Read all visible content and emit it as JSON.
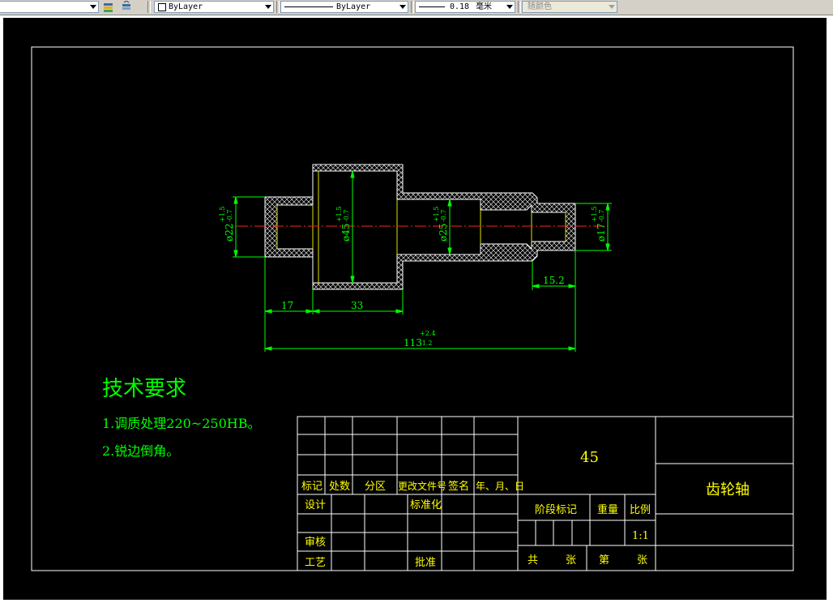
{
  "toolbar": {
    "color_layer_label": "ByLayer",
    "linetype_label": "ByLayer",
    "lineweight_value": "0.18",
    "lineweight_unit": "毫米",
    "plotstyle_label": "随颜色"
  },
  "drawing": {
    "dimensions": {
      "dia_left_sup": "+1.5",
      "dia_left_inf": "-0.7",
      "dia_left": "ø22",
      "dia_mid1_sup": "+1.5",
      "dia_mid1_inf": "-0.7",
      "dia_mid1": "ø45",
      "dia_mid2_sup": "+1.5",
      "dia_mid2_inf": "-0.7",
      "dia_mid2": "ø25",
      "dia_right_sup": "+1.5",
      "dia_right_inf": "-0.7",
      "dia_right": "ø17",
      "len_17": "17",
      "len_33": "33",
      "len_15_2": "15.2",
      "len_113": "113",
      "len_113_sup": "+2.4",
      "len_113_inf": "-1.2"
    },
    "tech_requirements": {
      "title": "技术要求",
      "item1": "1.调质处理220~250HB。",
      "item2": "2.锐边倒角。"
    },
    "title_block": {
      "material": "45",
      "part_name": "齿轮轴",
      "h_mark": "标记",
      "h_count": "处数",
      "h_zone": "分区",
      "h_doc": "更改文件号",
      "h_sign": "签名",
      "h_date": "年、月、日",
      "design": "设计",
      "standardization": "标准化",
      "review": "审核",
      "process": "工艺",
      "approve": "批准",
      "stage_mark": "阶段标记",
      "weight": "重量",
      "scale_label": "比例",
      "scale_value": "1:1",
      "total": "共",
      "sheet1": "张",
      "nth": "第",
      "sheet2": "张"
    }
  }
}
